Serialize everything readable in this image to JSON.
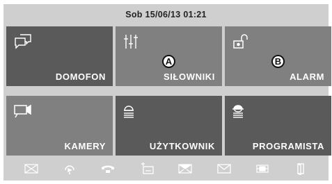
{
  "header": {
    "datetime": "Sob 15/06/13 01:21"
  },
  "tiles": [
    {
      "label": "DOMOFON",
      "icon": "intercom-chat-icon",
      "bg": "#5a5a5a"
    },
    {
      "label": "SIŁOWNIKI",
      "icon": "sliders-icon",
      "bg": "#808080"
    },
    {
      "label": "ALARM",
      "icon": "unlocked-padlock-icon",
      "bg": "#808080"
    },
    {
      "label": "KAMERY",
      "icon": "video-camera-icon",
      "bg": "#808080"
    },
    {
      "label": "UŻYTKOWNIK",
      "icon": "user-icon",
      "bg": "#5a5a5a"
    },
    {
      "label": "PROGRAMISTA",
      "icon": "installer-icon",
      "bg": "#5a5a5a"
    }
  ],
  "annotations": {
    "a": "A",
    "b": "B"
  },
  "bottom_bar": [
    {
      "icon": "envelope-crossed-icon"
    },
    {
      "icon": "speaker-icon"
    },
    {
      "icon": "phone-icon"
    },
    {
      "icon": "answering-machine-icon"
    },
    {
      "icon": "message-icon"
    },
    {
      "icon": "mail-icon"
    },
    {
      "icon": "gate-icon"
    },
    {
      "icon": "door-icon"
    }
  ],
  "colors": {
    "panel_bg": "#cfcfcf",
    "tile_dark": "#5a5a5a",
    "tile_light": "#808080",
    "icon_fg": "#ffffff"
  }
}
